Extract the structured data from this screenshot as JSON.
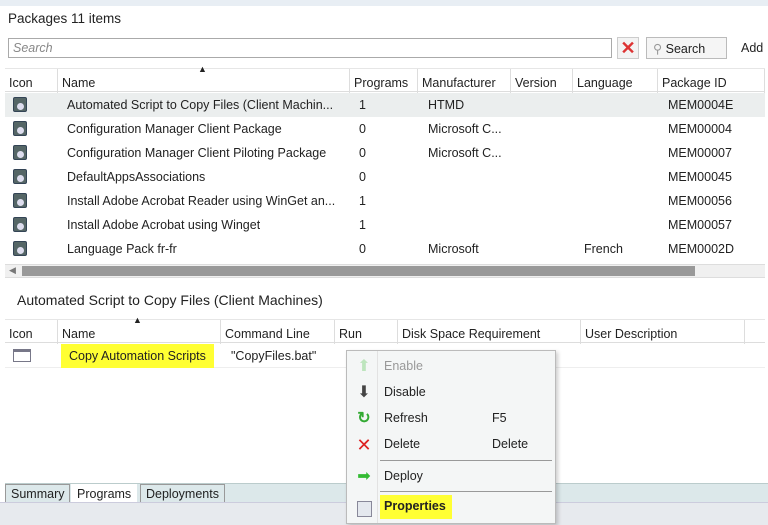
{
  "header": {
    "title": "Packages 11 items",
    "search_placeholder": "Search",
    "search_button": "Search",
    "add_label": "Add"
  },
  "packages": {
    "columns": [
      "Icon",
      "Name",
      "Programs",
      "Manufacturer",
      "Version",
      "Language",
      "Package ID"
    ],
    "rows": [
      {
        "name": "Automated Script to Copy Files (Client Machin...",
        "programs": "1",
        "manufacturer": "HTMD",
        "version": "",
        "language": "",
        "id": "MEM0004E"
      },
      {
        "name": "Configuration Manager Client Package",
        "programs": "0",
        "manufacturer": "Microsoft C...",
        "version": "",
        "language": "",
        "id": "MEM00004"
      },
      {
        "name": "Configuration Manager Client Piloting Package",
        "programs": "0",
        "manufacturer": "Microsoft C...",
        "version": "",
        "language": "",
        "id": "MEM00007"
      },
      {
        "name": "DefaultAppsAssociations",
        "programs": "0",
        "manufacturer": "",
        "version": "",
        "language": "",
        "id": "MEM00045"
      },
      {
        "name": "Install Adobe Acrobat Reader using WinGet an...",
        "programs": "1",
        "manufacturer": "",
        "version": "",
        "language": "",
        "id": "MEM00056"
      },
      {
        "name": "Install Adobe Acrobat using Winget",
        "programs": "1",
        "manufacturer": "",
        "version": "",
        "language": "",
        "id": "MEM00057"
      },
      {
        "name": "Language Pack fr-fr",
        "programs": "0",
        "manufacturer": "Microsoft",
        "version": "",
        "language": "French",
        "id": "MEM0002D"
      }
    ]
  },
  "details": {
    "title": "Automated Script to Copy Files (Client Machines)",
    "columns": [
      "Icon",
      "Name",
      "Command Line",
      "Run",
      "Disk Space Requirement",
      "User Description"
    ],
    "rows": [
      {
        "name": "Copy Automation Scripts",
        "command_line": "\"CopyFiles.bat\""
      }
    ]
  },
  "context_menu": [
    {
      "label": "Enable",
      "shortcut": "",
      "icon": "up-arrow-icon"
    },
    {
      "label": "Disable",
      "shortcut": "",
      "icon": "down-arrow-icon"
    },
    {
      "label": "Refresh",
      "shortcut": "F5",
      "icon": "refresh-icon"
    },
    {
      "label": "Delete",
      "shortcut": "Delete",
      "icon": "delete-x-icon"
    },
    {
      "label": "Deploy",
      "shortcut": "",
      "icon": "right-arrow-icon"
    },
    {
      "label": "Properties",
      "shortcut": "",
      "icon": "properties-icon"
    }
  ],
  "tabs": [
    "Summary",
    "Programs",
    "Deployments"
  ],
  "highlight_color": "#ffff33"
}
